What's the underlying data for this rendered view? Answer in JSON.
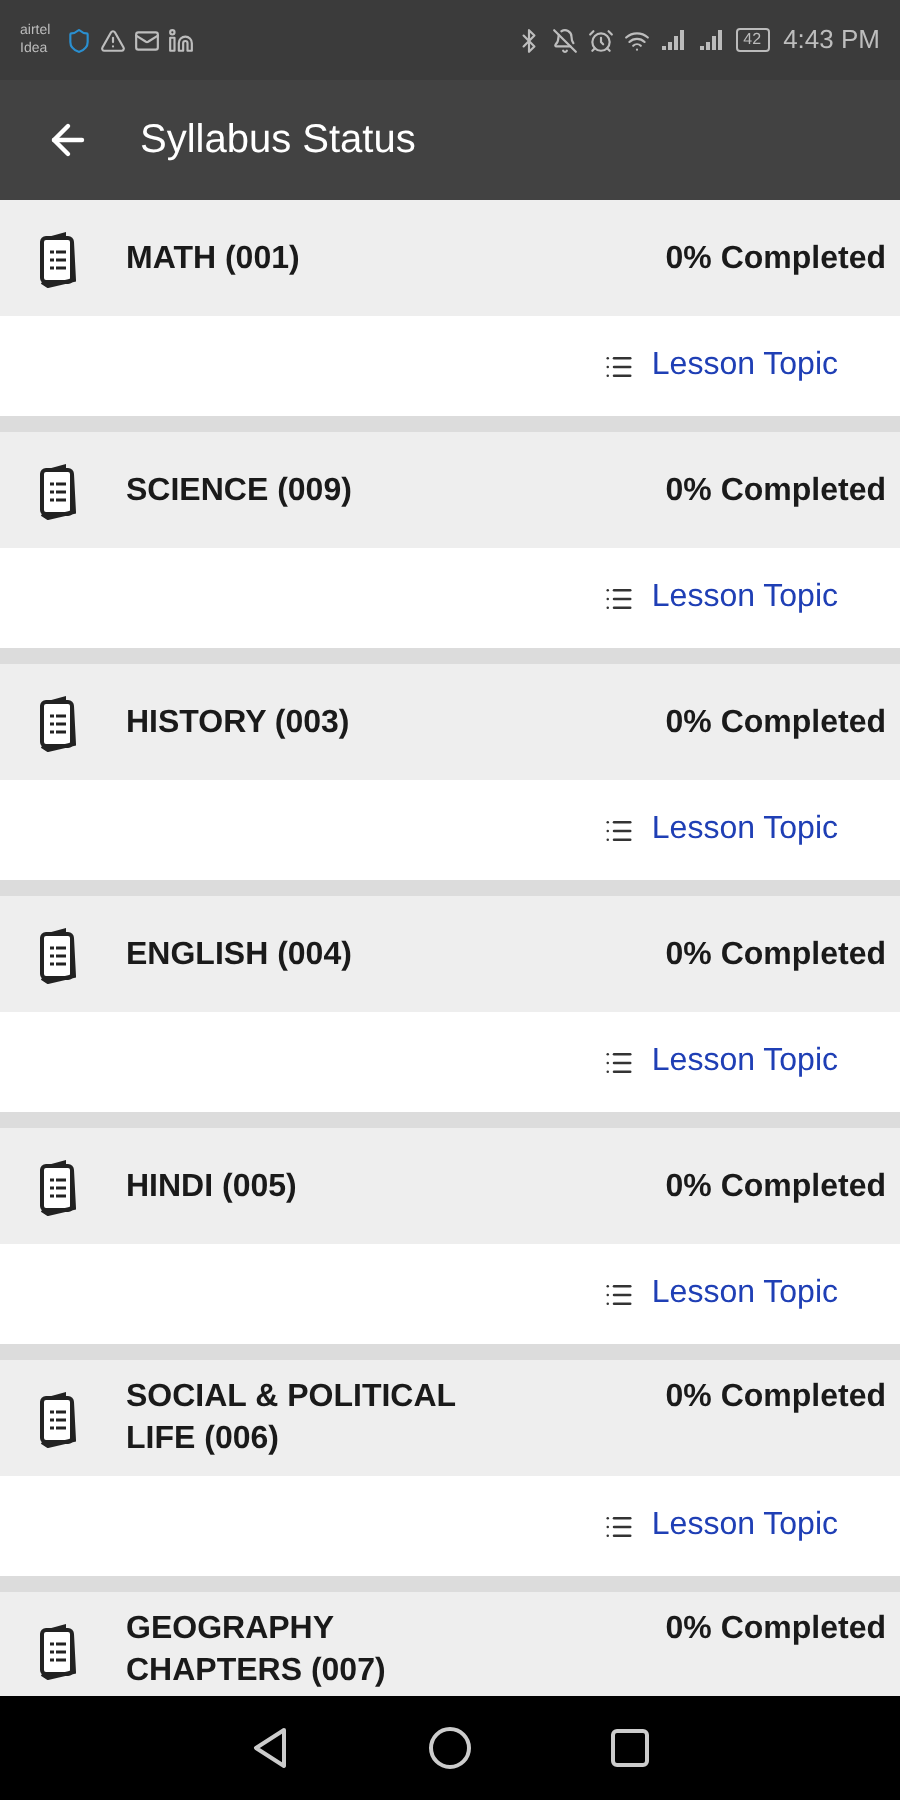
{
  "status_bar": {
    "carrier_top": "airtel",
    "carrier_bottom": "Idea",
    "battery": "42",
    "time": "4:43 PM"
  },
  "app_bar": {
    "title": "Syllabus Status"
  },
  "subjects": [
    {
      "title": "MATH (001)",
      "progress": "0% Completed",
      "link": "Lesson Topic"
    },
    {
      "title": "SCIENCE (009)",
      "progress": "0% Completed",
      "link": "Lesson Topic"
    },
    {
      "title": "HISTORY (003)",
      "progress": "0% Completed",
      "link": "Lesson Topic"
    },
    {
      "title": "ENGLISH (004)",
      "progress": "0% Completed",
      "link": "Lesson Topic"
    },
    {
      "title": "HINDI (005)",
      "progress": "0% Completed",
      "link": "Lesson Topic"
    },
    {
      "title": "SOCIAL & POLITICAL LIFE (006)",
      "progress": "0% Completed",
      "link": "Lesson Topic"
    },
    {
      "title": "GEOGRAPHY CHAPTERS (007)",
      "progress": "0% Completed"
    }
  ]
}
